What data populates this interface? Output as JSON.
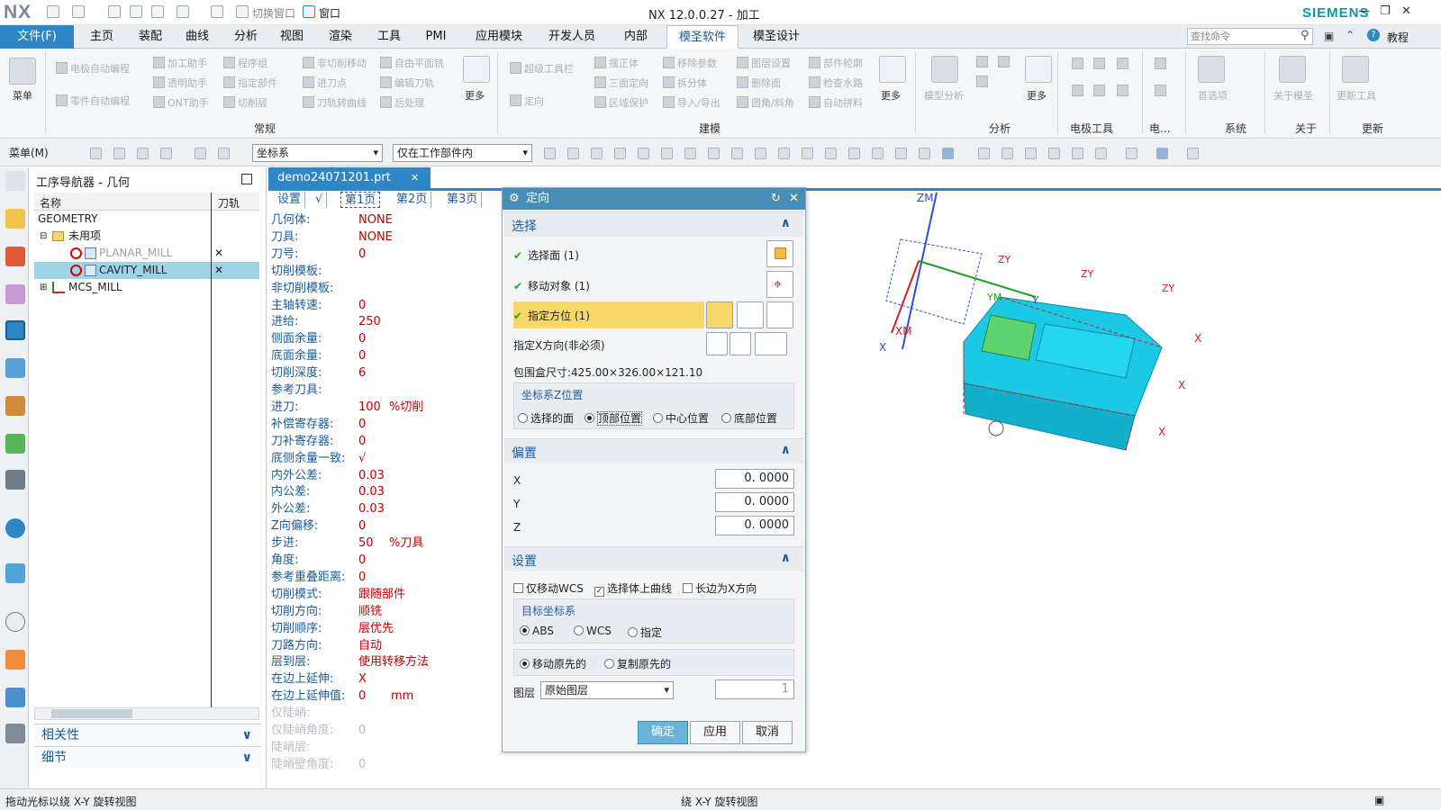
{
  "titlebar": {
    "logo": "NX",
    "switch_window": "切换窗口",
    "window_menu": "窗口",
    "title": "NX 12.0.0.27 - 加工",
    "brand": "SIEMENS"
  },
  "menubar": {
    "file": "文件(F)",
    "tabs": [
      "主页",
      "装配",
      "曲线",
      "分析",
      "视图",
      "渲染",
      "工具",
      "PMI",
      "应用模块",
      "开发人员",
      "内部",
      "模圣软件",
      "模圣设计"
    ],
    "active_tab": "模圣软件",
    "search_placeholder": "查找命令",
    "tutorial": "教程"
  },
  "ribbon": {
    "menu_label": "菜单",
    "col1": [
      "电极自动编程",
      "零件自动编程"
    ],
    "col2": [
      "加工助手",
      "透明助手",
      "ONT助手"
    ],
    "col3": [
      "程序组",
      "指定部件",
      "切削层"
    ],
    "col4": [
      "非切削移动",
      "进刀点",
      "刀轨转曲线"
    ],
    "col5": [
      "自由平面铣",
      "编辑刀轨",
      "后处理"
    ],
    "more": "更多",
    "col6": [
      "超级工具栏",
      "定向"
    ],
    "col7": [
      "摆正体",
      "三面定向",
      "区域保护"
    ],
    "col8": [
      "移除参数",
      "拆分体",
      "导入/导出"
    ],
    "col9": [
      "图层设置",
      "删除面",
      "圆角/斜角"
    ],
    "col10": [
      "部件轮廓",
      "检查水路",
      "自动拼料"
    ],
    "model_analysis": "模型分析",
    "preferences": "首选项",
    "about_mosheng": "关于模圣",
    "update_tools": "更新工具",
    "groups": [
      "常规",
      "建模",
      "分析",
      "电极工具",
      "电...",
      "系统",
      "关于",
      "更新"
    ]
  },
  "toolbar2": {
    "menu": "菜单(M)",
    "filter1": "坐标系",
    "filter2": "仅在工作部件内"
  },
  "navigator": {
    "title": "工序导航器 - 几何",
    "col_name": "名称",
    "col_path": "刀轨",
    "items": [
      {
        "label": "GEOMETRY",
        "level": 0
      },
      {
        "label": "未用项",
        "level": 1
      },
      {
        "label": "PLANAR_MILL",
        "level": 2,
        "mark": "✕"
      },
      {
        "label": "CAVITY_MILL",
        "level": 2,
        "mark": "✕"
      },
      {
        "label": "MCS_MILL",
        "level": 1
      }
    ],
    "relevance": "相关性",
    "details": "细节"
  },
  "document": {
    "tab": "demo24071201.prt",
    "page_tabs": [
      "设置",
      "√",
      "第1页",
      "第2页",
      "第3页"
    ],
    "params": [
      {
        "k": "几何体:",
        "v": "NONE"
      },
      {
        "k": "刀具:",
        "v": "NONE"
      },
      {
        "k": "刀号:",
        "v": "0"
      },
      {
        "k": "切削模板:",
        "v": ""
      },
      {
        "k": "非切削模板:",
        "v": ""
      },
      {
        "k": "主轴转速:",
        "v": "0"
      },
      {
        "k": "进给:",
        "v": "250"
      },
      {
        "k": "侧面余量:",
        "v": "0"
      },
      {
        "k": "底面余量:",
        "v": "0"
      },
      {
        "k": "切削深度:",
        "v": "6"
      },
      {
        "k": "参考刀具:",
        "v": ""
      },
      {
        "k": "进刀:",
        "v": "100",
        "u": "%切削"
      },
      {
        "k": "补偿寄存器:",
        "v": "0"
      },
      {
        "k": "刀补寄存器:",
        "v": "0"
      },
      {
        "k": "底侧余量一致:",
        "v": "√"
      },
      {
        "k": "内外公差:",
        "v": "0.03"
      },
      {
        "k": "内公差:",
        "v": "0.03"
      },
      {
        "k": "外公差:",
        "v": "0.03"
      },
      {
        "k": "Z向偏移:",
        "v": "0"
      },
      {
        "k": "步进:",
        "v": "50",
        "u": "%刀具"
      },
      {
        "k": "角度:",
        "v": "0"
      },
      {
        "k": "参考重叠距离:",
        "v": "0"
      },
      {
        "k": "切削模式:",
        "v": "跟随部件"
      },
      {
        "k": "切削方向:",
        "v": "顺铣"
      },
      {
        "k": "切削顺序:",
        "v": "层优先"
      },
      {
        "k": "刀路方向:",
        "v": "自动"
      },
      {
        "k": "层到层:",
        "v": "使用转移方法"
      },
      {
        "k": "在边上延伸:",
        "v": "X"
      },
      {
        "k": "在边上延伸值:",
        "v": "0",
        "u": "mm"
      },
      {
        "k": "仅陡峭:",
        "v": ""
      },
      {
        "k": "仅陡峭角度:",
        "v": "0"
      },
      {
        "k": "陡峭层:",
        "v": ""
      },
      {
        "k": "陡峭壁角度:",
        "v": "0"
      }
    ]
  },
  "dialog": {
    "title": "定向",
    "select_section": "选择",
    "select_face": "选择面 (1)",
    "move_object": "移动对象 (1)",
    "specify_orient": "指定方位 (1)",
    "specify_x": "指定X方向(非必须)",
    "bbox": "包围盒尺寸:425.00×326.00×121.10",
    "zpos_title": "坐标系Z位置",
    "zpos_options": [
      "选择的面",
      "顶部位置",
      "中心位置",
      "底部位置"
    ],
    "zpos_selected": 1,
    "offset_section": "偏置",
    "x_label": "X",
    "x_value": "0. 0000",
    "y_label": "Y",
    "y_value": "0. 0000",
    "z_label": "Z",
    "z_value": "0. 0000",
    "settings_section": "设置",
    "cb_move_wcs": "仅移动WCS",
    "cb_select_curves": "选择体上曲线",
    "cb_long_x": "长边为X方向",
    "target_title": "目标坐标系",
    "target_options": [
      "ABS",
      "WCS",
      "指定"
    ],
    "copy_options": [
      "移动原先的",
      "复制原先的"
    ],
    "layer_label": "图层",
    "layer_value": "原始图层",
    "layer_num": "1",
    "ok": "确定",
    "apply": "应用",
    "cancel": "取消"
  },
  "viewport": {
    "axis_zm": "ZM",
    "axis_xm": "XM",
    "axis_x": "X",
    "axis_y": "Y",
    "axis_ym": "YM",
    "axis_zy": "ZY"
  },
  "status": {
    "left": "拖动光标以绕 X-Y 旋转视图",
    "center": "绕 X-Y 旋转视图"
  },
  "colors": {
    "accent": "#2f86c6",
    "dialog_header": "#468eb5",
    "highlight": "#f9d86a",
    "model": "#22d0e8"
  }
}
